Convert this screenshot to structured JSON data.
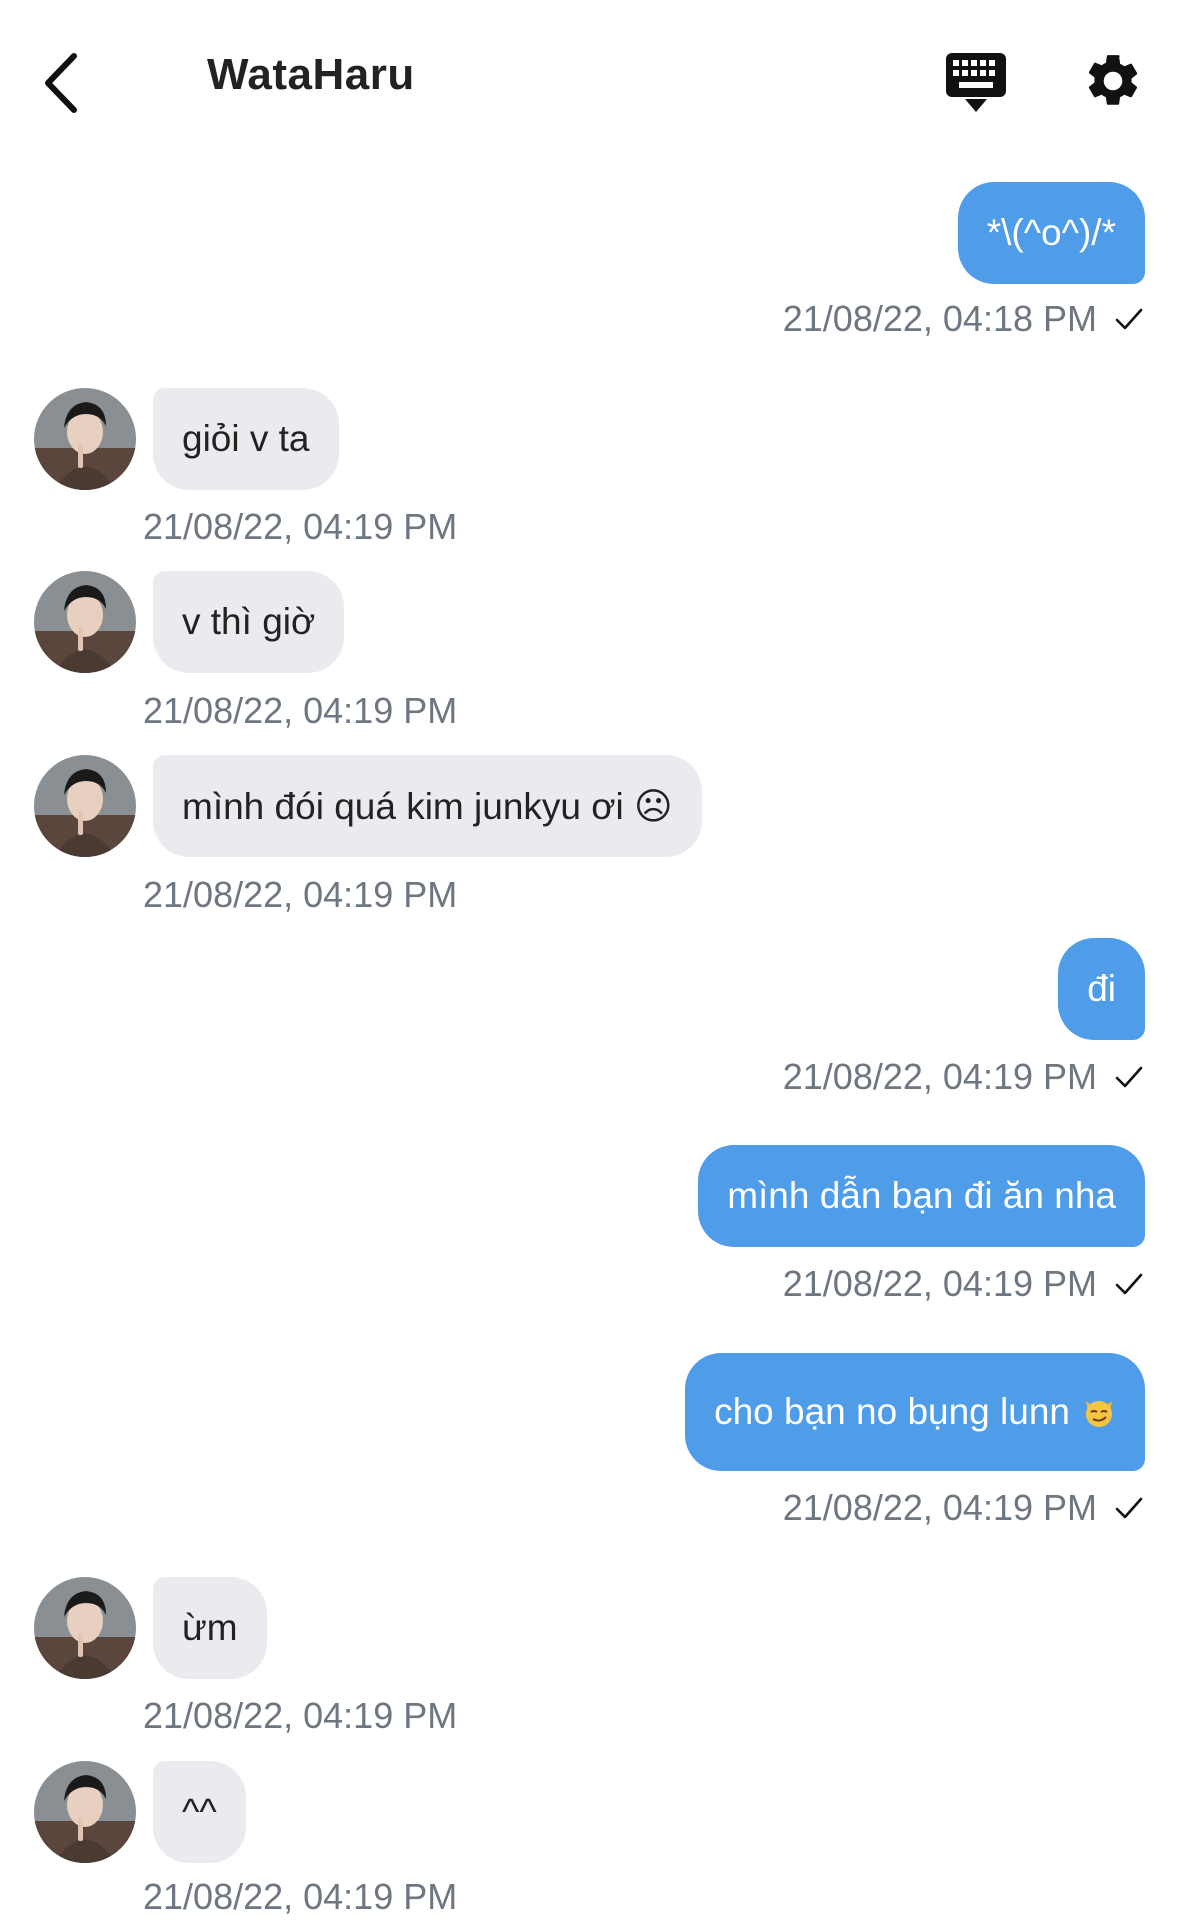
{
  "header": {
    "title": "WataHaru",
    "icons": {
      "back": "chevron-left-icon",
      "keyboard": "keyboard-icon",
      "settings": "gear-icon"
    }
  },
  "colors": {
    "outgoing_bubble": "#4f9ce8",
    "incoming_bubble": "#e9ebef",
    "timestamp": "#6e7681"
  },
  "messages": [
    {
      "direction": "out",
      "text": "*\\(^o^)/*",
      "time": "21/08/22, 04:18 PM",
      "status": "sent"
    },
    {
      "direction": "in",
      "text": "giỏi v ta",
      "time": "21/08/22, 04:19 PM"
    },
    {
      "direction": "in",
      "text": "v thì giờ",
      "time": "21/08/22, 04:19 PM"
    },
    {
      "direction": "in",
      "text": "mình đói quá kim junkyu ơi ☹",
      "time": "21/08/22, 04:19 PM"
    },
    {
      "direction": "out",
      "text": "đi",
      "time": "21/08/22, 04:19 PM",
      "status": "sent"
    },
    {
      "direction": "out",
      "text": "mình dẫn bạn đi ăn nha",
      "time": "21/08/22, 04:19 PM",
      "status": "sent"
    },
    {
      "direction": "out",
      "text": "cho bạn no bụng lunn",
      "emoji": "smirking-cat-icon",
      "time": "21/08/22, 04:19 PM",
      "status": "sent"
    },
    {
      "direction": "in",
      "text": "ừm",
      "time": "21/08/22, 04:19 PM"
    },
    {
      "direction": "in",
      "text": "^^",
      "time": "21/08/22, 04:19 PM"
    }
  ]
}
